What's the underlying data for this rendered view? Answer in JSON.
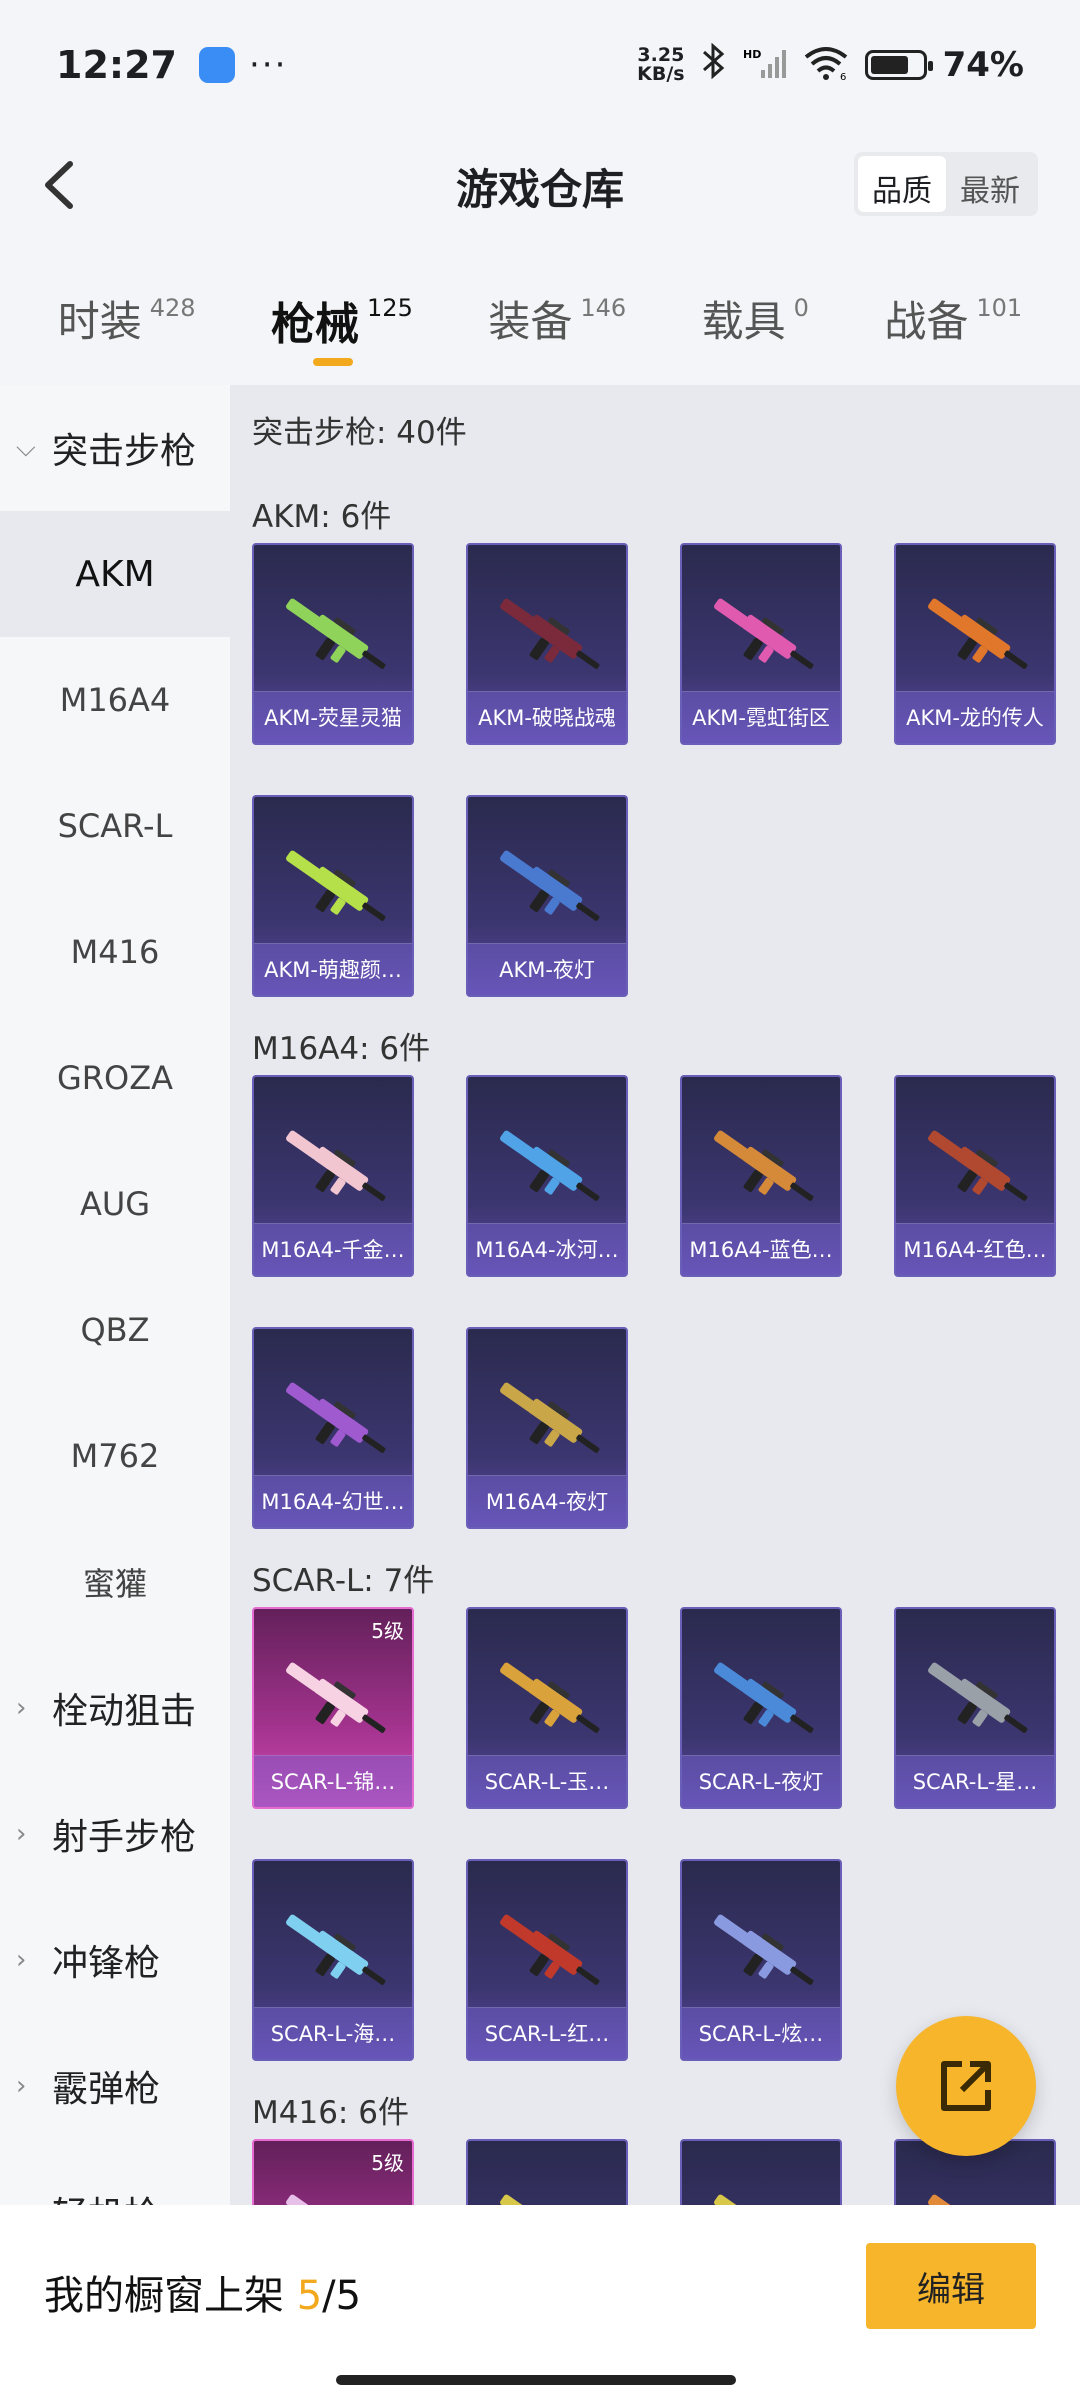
{
  "status_bar": {
    "time": "12:27",
    "net_speed_top": "3.25",
    "net_speed_bottom": "KB/s",
    "hd_label": "HD",
    "wifi_label": "6",
    "battery": "74%"
  },
  "header": {
    "title": "游戏仓库",
    "sort_options": [
      "品质",
      "最新"
    ],
    "sort_selected": "品质"
  },
  "tabs": [
    {
      "label": "时装",
      "count": "428"
    },
    {
      "label": "枪械",
      "count": "125"
    },
    {
      "label": "装备",
      "count": "146"
    },
    {
      "label": "载具",
      "count": "0"
    },
    {
      "label": "战备",
      "count": "101"
    }
  ],
  "sidebar": {
    "expanded_category": "突击步枪",
    "sub_items": [
      "AKM",
      "M16A4",
      "SCAR-L",
      "M416",
      "GROZA",
      "AUG",
      "QBZ",
      "M762",
      "蜜獾"
    ],
    "categories": [
      "栓动狙击",
      "射手步枪",
      "冲锋枪",
      "霰弹枪",
      "轻机枪"
    ]
  },
  "content": {
    "summary": "突击步枪: 40件",
    "groups": [
      {
        "title": "AKM: 6件",
        "items": [
          {
            "name": "AKM-荧星灵猫",
            "gun_color": "#8fd35a"
          },
          {
            "name": "AKM-破晓战魂",
            "gun_color": "#7a2a3a"
          },
          {
            "name": "AKM-霓虹街区",
            "gun_color": "#e05ab0"
          },
          {
            "name": "AKM-龙的传人",
            "gun_color": "#e0772a"
          },
          {
            "name": "AKM-萌趣颜…",
            "gun_color": "#b6e04a"
          },
          {
            "name": "AKM-夜灯",
            "gun_color": "#4a7ad0"
          }
        ]
      },
      {
        "title": "M16A4: 6件",
        "items": [
          {
            "name": "M16A4-千金…",
            "gun_color": "#f2c6d0"
          },
          {
            "name": "M16A4-冰河…",
            "gun_color": "#4fa3e6"
          },
          {
            "name": "M16A4-蓝色…",
            "gun_color": "#d58a3a"
          },
          {
            "name": "M16A4-红色…",
            "gun_color": "#b0492f"
          },
          {
            "name": "M16A4-幻世…",
            "gun_color": "#a05ad0"
          },
          {
            "name": "M16A4-夜灯",
            "gun_color": "#c9a648"
          }
        ]
      },
      {
        "title": "SCAR-L: 7件",
        "items": [
          {
            "name": "SCAR-L-锦…",
            "gun_color": "#f7d2e2",
            "level": "5级",
            "legend": true
          },
          {
            "name": "SCAR-L-玉…",
            "gun_color": "#d9a23a"
          },
          {
            "name": "SCAR-L-夜灯",
            "gun_color": "#4a8ad8"
          },
          {
            "name": "SCAR-L-星…",
            "gun_color": "#9aa0a8"
          },
          {
            "name": "SCAR-L-海…",
            "gun_color": "#7fd0f0"
          },
          {
            "name": "SCAR-L-红…",
            "gun_color": "#c0392b"
          },
          {
            "name": "SCAR-L-炫…",
            "gun_color": "#8a9ae0"
          }
        ]
      },
      {
        "title": "M416: 6件",
        "items": [
          {
            "name": "",
            "gun_color": "#e6c0e8",
            "level": "5级",
            "legend": true
          },
          {
            "name": "",
            "gun_color": "#d8c84a"
          },
          {
            "name": "",
            "gun_color": "#d8c84a"
          },
          {
            "name": "",
            "gun_color": "#e08a3a"
          }
        ]
      }
    ]
  },
  "bottom": {
    "label_prefix": "我的橱窗上架 ",
    "count_current": "5",
    "count_sep": "/",
    "count_total": "5",
    "edit_label": "编辑"
  }
}
